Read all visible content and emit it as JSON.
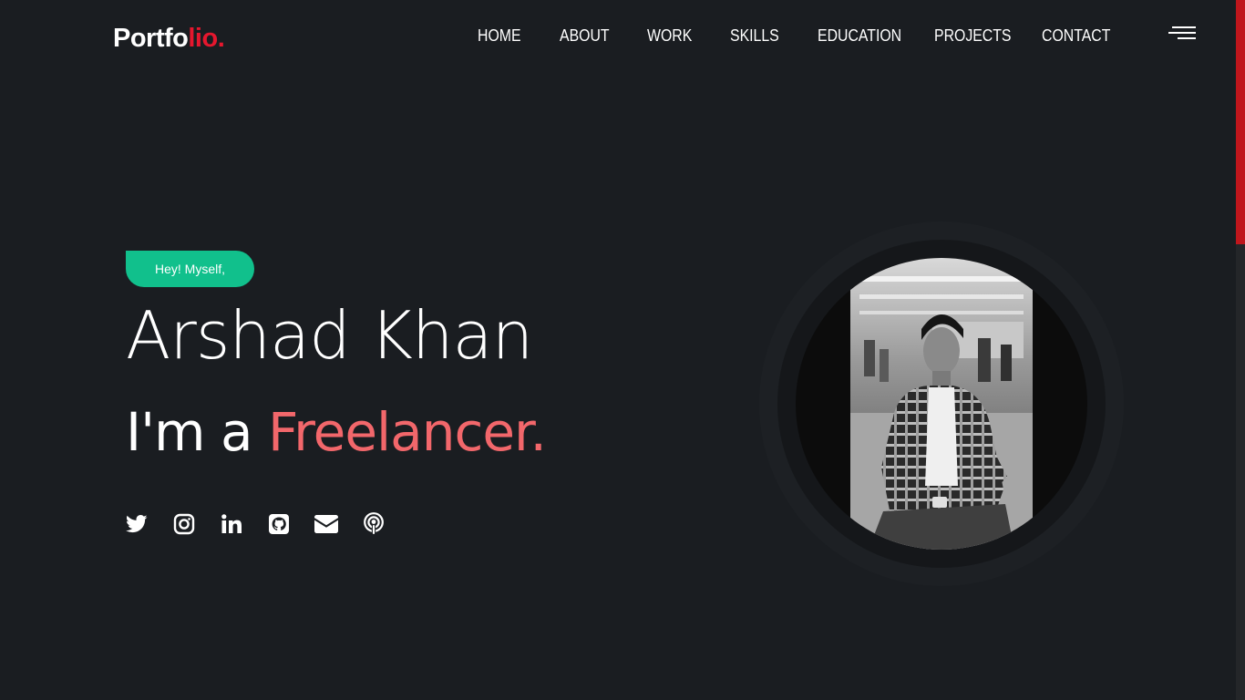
{
  "header": {
    "logo_main": "Portfo",
    "logo_accent": "lio.",
    "nav": [
      "HOME",
      "ABOUT",
      "WORK",
      "SKILLS",
      "EDUCATION",
      "PROJECTS",
      "CONTACT"
    ],
    "menu_icon": "hamburger-menu-icon"
  },
  "hero": {
    "badge": "Hey! Myself,",
    "name": "Arshad Khan",
    "role_prefix": "I'm a",
    "role_accent": "Freelancer.",
    "socials": [
      "twitter-icon",
      "instagram-icon",
      "linkedin-icon",
      "github-icon",
      "email-icon",
      "podcast-icon"
    ]
  },
  "colors": {
    "background": "#1a1d21",
    "accent_red": "#e6172e",
    "accent_coral": "#f2676b",
    "badge_green": "#11c08c",
    "scrollbar_thumb": "#c0161c"
  }
}
